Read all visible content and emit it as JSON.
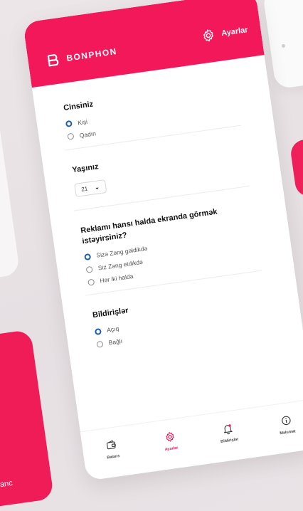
{
  "brand": {
    "name": "BONPHON"
  },
  "header": {
    "settings_label": "Ayarlar"
  },
  "gender": {
    "title": "Cinsiniz",
    "options": [
      "Kişi",
      "Qadın"
    ],
    "selected": 0
  },
  "age": {
    "title": "Yaşınız",
    "value": "21"
  },
  "ads": {
    "title": "Reklamı hansı halda ekranda görmək istəyirsiniz?",
    "options": [
      "Sizə Zəng gəldikdə",
      "Siz Zəng etdikdə",
      "Hər iki halda"
    ],
    "selected": 0
  },
  "notifications": {
    "title": "Bildirişlər",
    "options": [
      "Açıq",
      "Bağlı"
    ],
    "selected": 0
  },
  "tabs": [
    {
      "label": "Balans",
      "icon": "wallet-icon"
    },
    {
      "label": "Ayarlar",
      "icon": "gear-icon"
    },
    {
      "label": "Bildirişlər",
      "icon": "bell-icon"
    },
    {
      "label": "Məlumat",
      "icon": "info-icon"
    }
  ],
  "background": {
    "partial_text": "anc"
  },
  "colors": {
    "accent": "#f2185a",
    "radio_selected": "#1d5fa8"
  }
}
